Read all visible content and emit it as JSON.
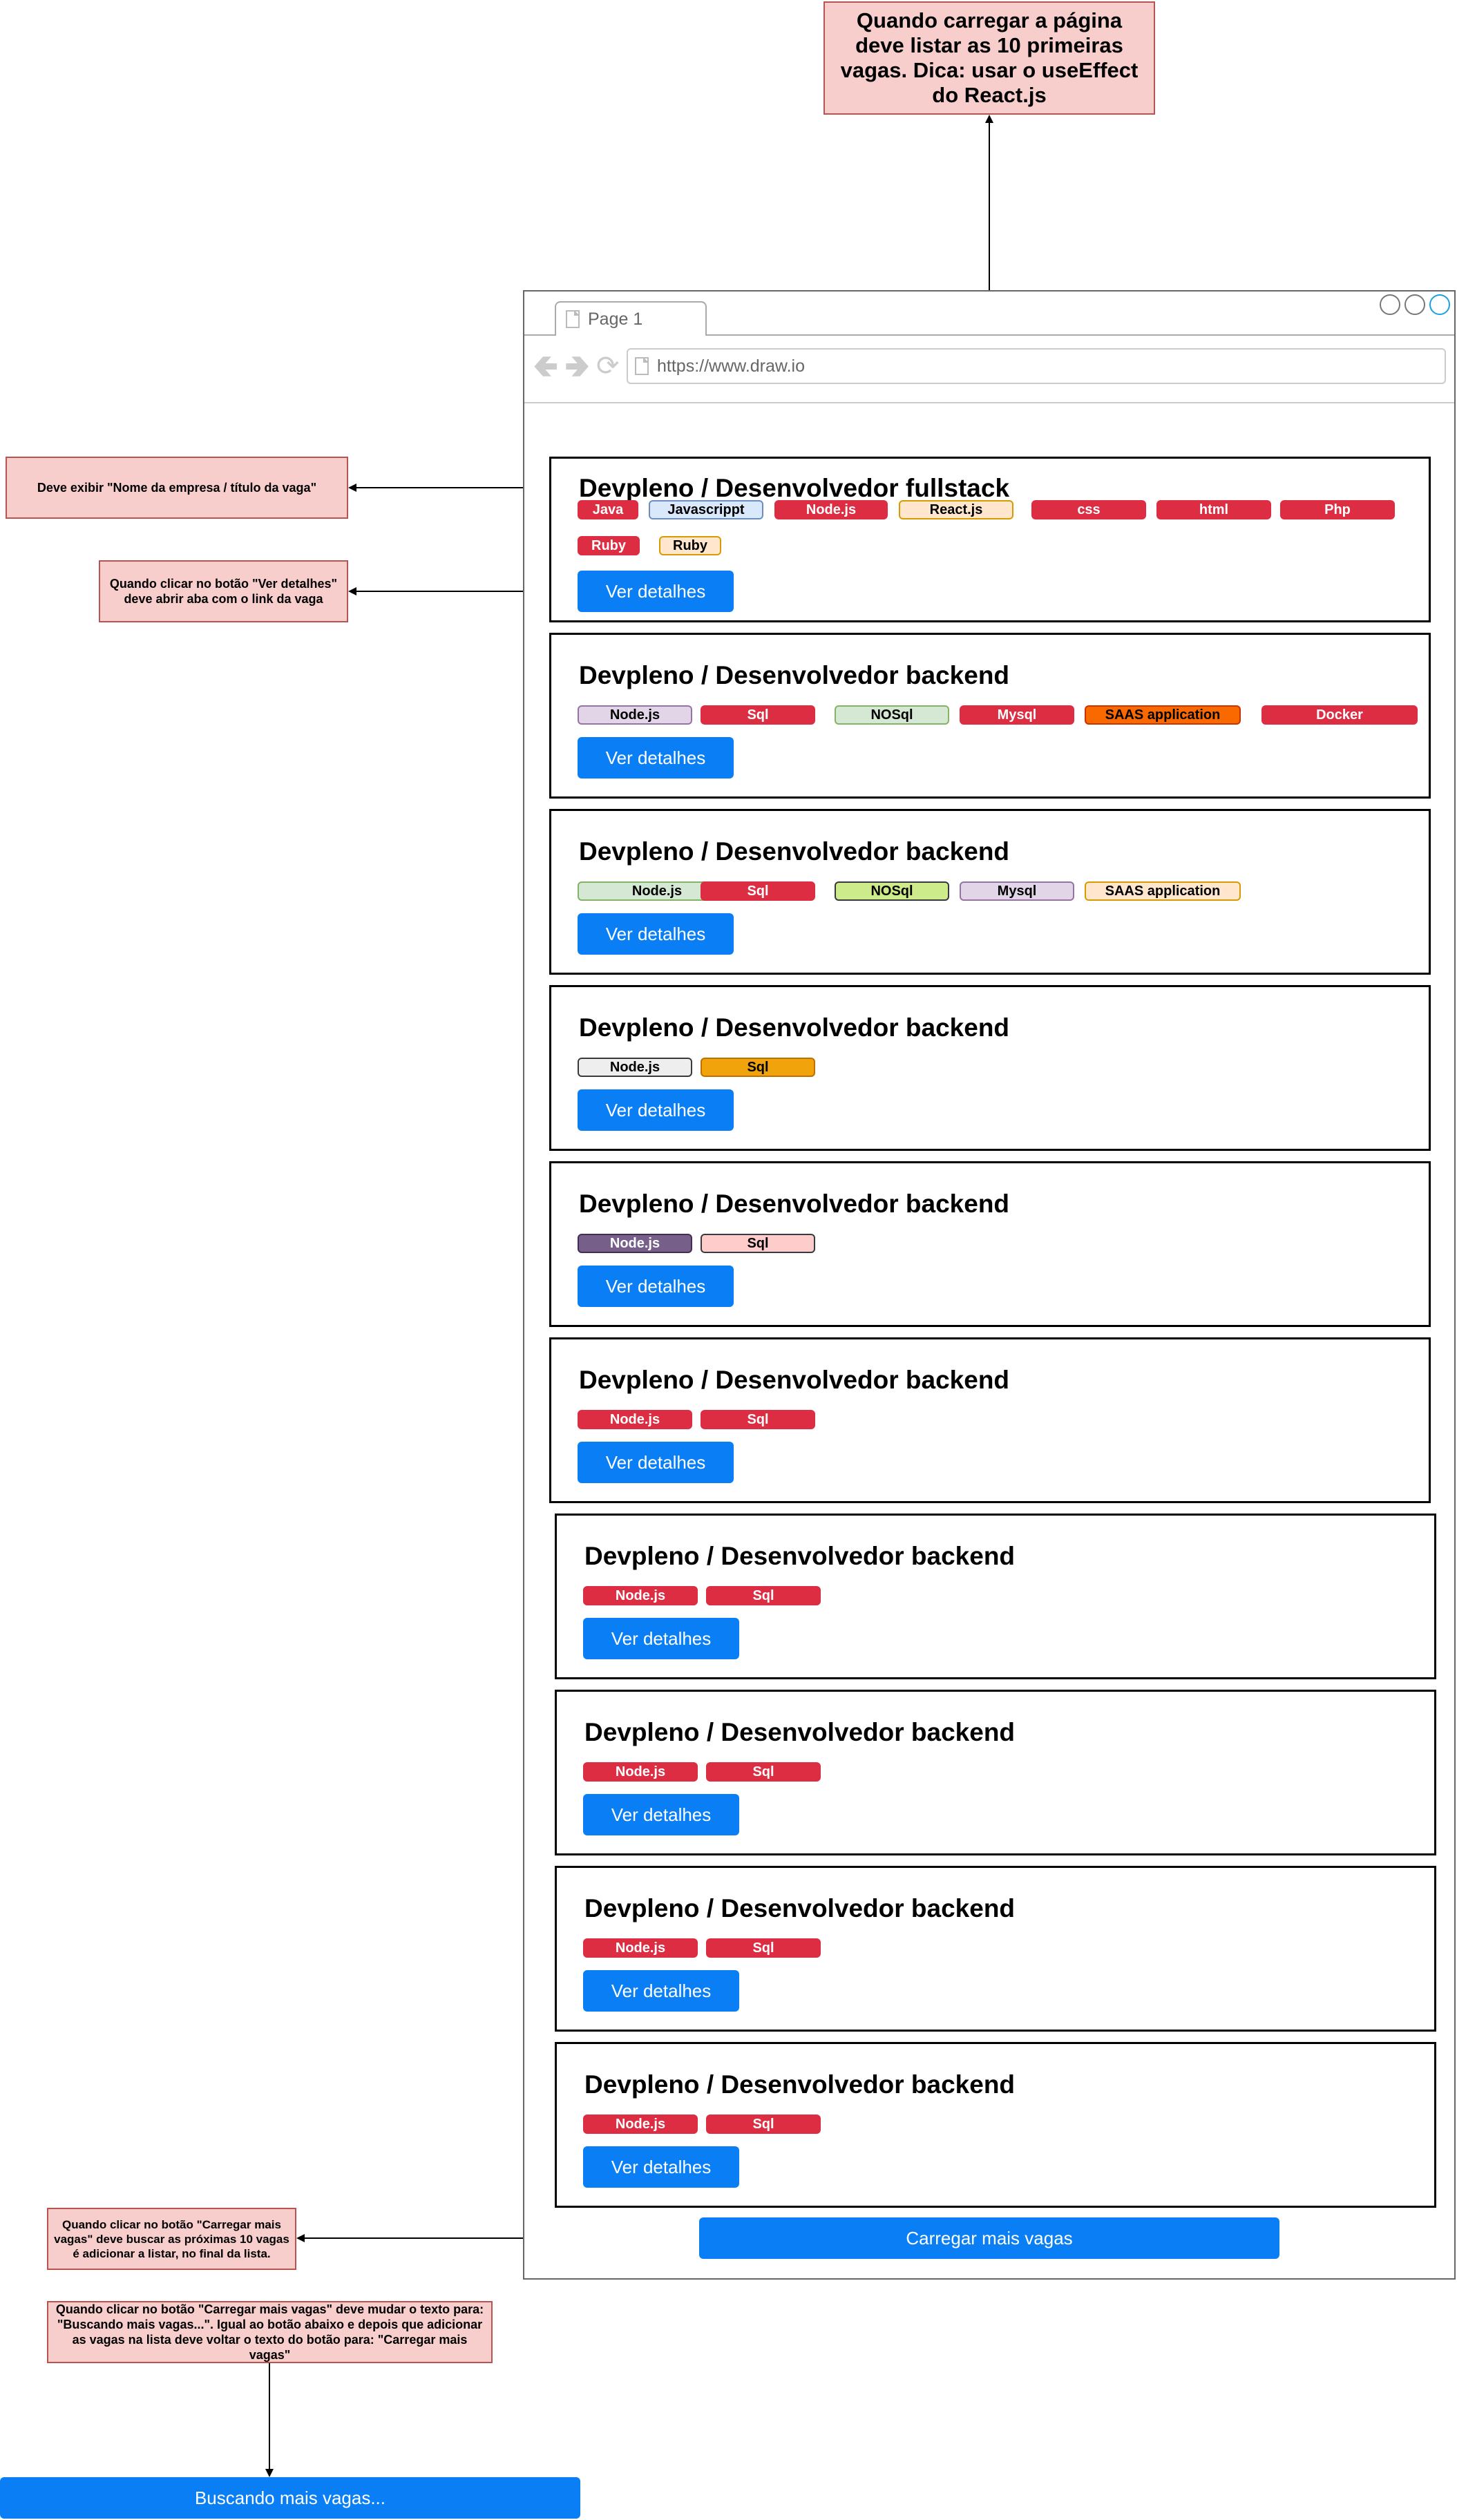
{
  "notes": {
    "top": "Quando carregar a página deve listar as 10 primeiras vagas. Dica: usar o useEffect do React.js",
    "title": "Deve exibir \"Nome da empresa / título da vaga\"",
    "ver_detalhes": "Quando clicar no botão \"Ver detalhes\" deve abrir aba com o link da vaga",
    "carregar": "Quando clicar no botão \"Carregar mais vagas\" deve buscar as próximas 10 vagas é adicionar a listar, no final da lista.",
    "buscando": "Quando clicar no botão \"Carregar mais vagas\" deve mudar o texto para: \"Buscando mais vagas...\". Igual ao botão abaixo e depois que adicionar as vagas na lista deve voltar o texto do botão para: \"Carregar mais vagas\""
  },
  "browser": {
    "tab_label": "Page 1",
    "url": "https://www.draw.io"
  },
  "jobs": [
    {
      "title": "Devpleno / Desenvolvedor fullstack",
      "tags": [
        {
          "label": "Java",
          "bg": "#dc2d43",
          "color": "#ffffff",
          "border": "#dc2d43"
        },
        {
          "label": "Javascrippt",
          "bg": "#dae8fc",
          "color": "#000000",
          "border": "#6c8ebf"
        },
        {
          "label": "Node.js",
          "bg": "#dc2d43",
          "color": "#ffffff",
          "border": "#dc2d43"
        },
        {
          "label": "React.js",
          "bg": "#ffe6cc",
          "color": "#000000",
          "border": "#d79b00"
        },
        {
          "label": "css",
          "bg": "#dc2d43",
          "color": "#ffffff",
          "border": "#dc2d43"
        },
        {
          "label": "html",
          "bg": "#dc2d43",
          "color": "#ffffff",
          "border": "#dc2d43"
        },
        {
          "label": "Php",
          "bg": "#dc2d43",
          "color": "#ffffff",
          "border": "#dc2d43"
        },
        {
          "label": "Ruby",
          "bg": "#dc2d43",
          "color": "#ffffff",
          "border": "#dc2d43"
        },
        {
          "label": "Ruby",
          "bg": "#ffe6cc",
          "color": "#000000",
          "border": "#d79b00"
        }
      ],
      "button": "Ver detalhes"
    },
    {
      "title": "Devpleno / Desenvolvedor backend",
      "tags": [
        {
          "label": "Node.js",
          "bg": "#e1d5e7",
          "color": "#000000",
          "border": "#9673a6"
        },
        {
          "label": "Sql",
          "bg": "#dc2d43",
          "color": "#ffffff",
          "border": "#dc2d43"
        },
        {
          "label": "NOSql",
          "bg": "#d5e8d4",
          "color": "#000000",
          "border": "#82b366"
        },
        {
          "label": "Mysql",
          "bg": "#dc2d43",
          "color": "#ffffff",
          "border": "#dc2d43"
        },
        {
          "label": "SAAS application",
          "bg": "#fa6800",
          "color": "#000000",
          "border": "#c73500"
        },
        {
          "label": "Docker",
          "bg": "#dc2d43",
          "color": "#ffffff",
          "border": "#dc2d43"
        }
      ],
      "button": "Ver detalhes"
    },
    {
      "title": "Devpleno / Desenvolvedor backend",
      "tags": [
        {
          "label": "Node.js",
          "bg": "#d5e8d4",
          "color": "#000000",
          "border": "#82b366"
        },
        {
          "label": "Sql",
          "bg": "#dc2d43",
          "color": "#ffffff",
          "border": "#dc2d43"
        },
        {
          "label": "NOSql",
          "bg": "#cdeb8b",
          "color": "#000000",
          "border": "#36393d"
        },
        {
          "label": "Mysql",
          "bg": "#e1d5e7",
          "color": "#000000",
          "border": "#9673a6"
        },
        {
          "label": "SAAS application",
          "bg": "#ffe6cc",
          "color": "#000000",
          "border": "#d79b00"
        }
      ],
      "button": "Ver detalhes"
    },
    {
      "title": "Devpleno / Desenvolvedor backend",
      "tags": [
        {
          "label": "Node.js",
          "bg": "#eeeeee",
          "color": "#000000",
          "border": "#36393d"
        },
        {
          "label": "Sql",
          "bg": "#f0a30a",
          "color": "#000000",
          "border": "#bd7000"
        }
      ],
      "button": "Ver detalhes"
    },
    {
      "title": "Devpleno / Desenvolvedor backend",
      "tags": [
        {
          "label": "Node.js",
          "bg": "#76608a",
          "color": "#ffffff",
          "border": "#432d57"
        },
        {
          "label": "Sql",
          "bg": "#ffcccc",
          "color": "#000000",
          "border": "#36393d"
        }
      ],
      "button": "Ver detalhes"
    },
    {
      "title": "Devpleno / Desenvolvedor backend",
      "tags": [
        {
          "label": "Node.js",
          "bg": "#dc2d43",
          "color": "#ffffff",
          "border": "#dc2d43"
        },
        {
          "label": "Sql",
          "bg": "#dc2d43",
          "color": "#ffffff",
          "border": "#dc2d43"
        }
      ],
      "button": "Ver detalhes"
    },
    {
      "title": "Devpleno / Desenvolvedor backend",
      "tags": [
        {
          "label": "Node.js",
          "bg": "#dc2d43",
          "color": "#ffffff",
          "border": "#dc2d43"
        },
        {
          "label": "Sql",
          "bg": "#dc2d43",
          "color": "#ffffff",
          "border": "#dc2d43"
        }
      ],
      "button": "Ver detalhes"
    },
    {
      "title": "Devpleno / Desenvolvedor backend",
      "tags": [
        {
          "label": "Node.js",
          "bg": "#dc2d43",
          "color": "#ffffff",
          "border": "#dc2d43"
        },
        {
          "label": "Sql",
          "bg": "#dc2d43",
          "color": "#ffffff",
          "border": "#dc2d43"
        }
      ],
      "button": "Ver detalhes"
    },
    {
      "title": "Devpleno / Desenvolvedor backend",
      "tags": [
        {
          "label": "Node.js",
          "bg": "#dc2d43",
          "color": "#ffffff",
          "border": "#dc2d43"
        },
        {
          "label": "Sql",
          "bg": "#dc2d43",
          "color": "#ffffff",
          "border": "#dc2d43"
        }
      ],
      "button": "Ver detalhes"
    },
    {
      "title": "Devpleno / Desenvolvedor backend",
      "tags": [
        {
          "label": "Node.js",
          "bg": "#dc2d43",
          "color": "#ffffff",
          "border": "#dc2d43"
        },
        {
          "label": "Sql",
          "bg": "#dc2d43",
          "color": "#ffffff",
          "border": "#dc2d43"
        }
      ],
      "button": "Ver detalhes"
    }
  ],
  "buttons": {
    "load_more": "Carregar mais vagas",
    "loading": "Buscando mais vagas..."
  },
  "colors": {
    "button_blue": "#0a7ff5",
    "note_fill": "#f8cecc",
    "note_border": "#b85450",
    "window_button_active": "#1ba1e2"
  }
}
